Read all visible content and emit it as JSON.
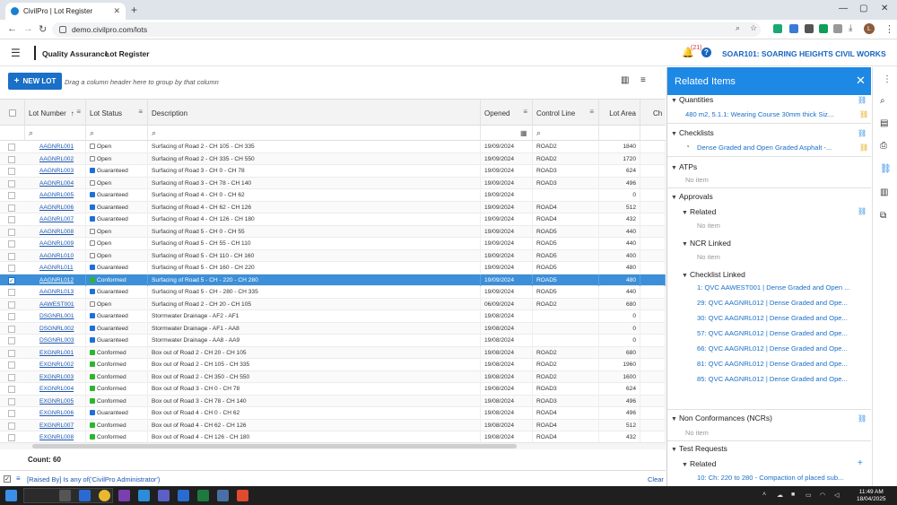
{
  "browser": {
    "tab_title": "CivilPro | Lot Register",
    "url": "demo.civilpro.com/lots",
    "profile_initial": "L"
  },
  "app": {
    "module": "Quality Assurance",
    "page": "Lot Register",
    "notification_count": "(21)",
    "org": "SOAR101: SOARING HEIGHTS CIVIL WORKS"
  },
  "toolbar": {
    "new_lot_label": "NEW LOT",
    "group_hint": "Drag a column header here to group by that column"
  },
  "grid": {
    "columns": [
      "Lot Number",
      "Lot Status",
      "Description",
      "Opened",
      "Control Line",
      "Lot Area",
      "Ch"
    ],
    "rows": [
      {
        "lot": "AAGNRL001",
        "status": "Open",
        "desc": "Surfacing of Road 2 - CH 105 - CH 335",
        "opened": "19/09/2024",
        "cl": "ROAD2",
        "area": "1840"
      },
      {
        "lot": "AAGNRL002",
        "status": "Open",
        "desc": "Surfacing of Road 2 - CH 335 - CH 550",
        "opened": "19/09/2024",
        "cl": "ROAD2",
        "area": "1720"
      },
      {
        "lot": "AAGNRL003",
        "status": "Guaranteed",
        "desc": "Surfacing of Road 3 - CH 0 - CH 78",
        "opened": "19/09/2024",
        "cl": "ROAD3",
        "area": "624"
      },
      {
        "lot": "AAGNRL004",
        "status": "Open",
        "desc": "Surfacing of Road 3 - CH 78 - CH 140",
        "opened": "19/09/2024",
        "cl": "ROAD3",
        "area": "496"
      },
      {
        "lot": "AAGNRL005",
        "status": "Guaranteed",
        "desc": "Surfacing of Road 4 - CH 0 - CH 62",
        "opened": "19/09/2024",
        "cl": "",
        "area": "0"
      },
      {
        "lot": "AAGNRL006",
        "status": "Guaranteed",
        "desc": "Surfacing of Road 4 - CH 62 - CH 126",
        "opened": "19/09/2024",
        "cl": "ROAD4",
        "area": "512"
      },
      {
        "lot": "AAGNRL007",
        "status": "Guaranteed",
        "desc": "Surfacing of Road 4 - CH 126 - CH 180",
        "opened": "19/09/2024",
        "cl": "ROAD4",
        "area": "432"
      },
      {
        "lot": "AAGNRL008",
        "status": "Open",
        "desc": "Surfacing of Road 5 - CH 0 - CH 55",
        "opened": "19/09/2024",
        "cl": "ROAD5",
        "area": "440"
      },
      {
        "lot": "AAGNRL009",
        "status": "Open",
        "desc": "Surfacing of Road 5 - CH 55 - CH 110",
        "opened": "19/09/2024",
        "cl": "ROAD5",
        "area": "440"
      },
      {
        "lot": "AAGNRL010",
        "status": "Open",
        "desc": "Surfacing of Road 5 - CH 110 - CH 160",
        "opened": "19/09/2024",
        "cl": "ROAD5",
        "area": "400"
      },
      {
        "lot": "AAGNRL011",
        "status": "Guaranteed",
        "desc": "Surfacing of Road 5 - CH 160 - CH 220",
        "opened": "19/09/2024",
        "cl": "ROAD5",
        "area": "480"
      },
      {
        "lot": "AAGNRL012",
        "status": "Conformed",
        "desc": "Surfacing of Road 5 - CH - 220 - CH 280",
        "opened": "19/09/2024",
        "cl": "ROAD5",
        "area": "480",
        "selected": true
      },
      {
        "lot": "AAGNRL013",
        "status": "Guaranteed",
        "desc": "Surfacing of Road 5 - CH - 280 - CH 335",
        "opened": "19/09/2024",
        "cl": "ROAD5",
        "area": "440"
      },
      {
        "lot": "AAWEST001",
        "status": "Open",
        "desc": "Surfacing of Road 2 - CH 20 - CH 105",
        "opened": "06/09/2024",
        "cl": "ROAD2",
        "area": "680"
      },
      {
        "lot": "DSGNRL001",
        "status": "Guaranteed",
        "desc": "Stormwater Drainage - AF2 - AF1",
        "opened": "19/08/2024",
        "cl": "",
        "area": "0"
      },
      {
        "lot": "DSGNRL002",
        "status": "Guaranteed",
        "desc": "Stormwater Drainage - AF1 - AA8",
        "opened": "19/08/2024",
        "cl": "",
        "area": "0"
      },
      {
        "lot": "DSGNRL003",
        "status": "Guaranteed",
        "desc": "Stormwater Drainage - AA8 - AA9",
        "opened": "19/08/2024",
        "cl": "",
        "area": "0"
      },
      {
        "lot": "EXGNRL001",
        "status": "Conformed",
        "desc": "Box out of Road 2 - CH 20 - CH 105",
        "opened": "19/08/2024",
        "cl": "ROAD2",
        "area": "680"
      },
      {
        "lot": "EXGNRL002",
        "status": "Conformed",
        "desc": "Box out of Road 2 - CH 105 - CH 335",
        "opened": "19/08/2024",
        "cl": "ROAD2",
        "area": "1960"
      },
      {
        "lot": "EXGNRL003",
        "status": "Conformed",
        "desc": "Box out of Road 2 - CH 350 - CH 550",
        "opened": "19/08/2024",
        "cl": "ROAD2",
        "area": "1600"
      },
      {
        "lot": "EXGNRL004",
        "status": "Conformed",
        "desc": "Box out of Road 3 - CH 0 - CH 78",
        "opened": "19/08/2024",
        "cl": "ROAD3",
        "area": "624"
      },
      {
        "lot": "EXGNRL005",
        "status": "Conformed",
        "desc": "Box out of Road 3 - CH 78 - CH 140",
        "opened": "19/08/2024",
        "cl": "ROAD3",
        "area": "496"
      },
      {
        "lot": "EXGNRL006",
        "status": "Guaranteed",
        "desc": "Box out of Road 4 - CH 0 - CH 62",
        "opened": "19/08/2024",
        "cl": "ROAD4",
        "area": "496"
      },
      {
        "lot": "EXGNRL007",
        "status": "Conformed",
        "desc": "Box out of Road 4 - CH 62 - CH 126",
        "opened": "19/08/2024",
        "cl": "ROAD4",
        "area": "512"
      },
      {
        "lot": "EXGNRL008",
        "status": "Conformed",
        "desc": "Box out of Road 4 - CH 126 - CH 180",
        "opened": "19/08/2024",
        "cl": "ROAD4",
        "area": "432"
      }
    ],
    "count_label": "Count: 60",
    "active_filter": "[Raised By] Is any of('CivilPro Administrator')",
    "clear_label": "Clear"
  },
  "status_colors": {
    "Open": "#ffffff",
    "Guaranteed": "#1e6fd9",
    "Conformed": "#2db52d"
  },
  "related": {
    "title": "Related Items",
    "quantities_label": "Quantities",
    "quantities_item": "480 m2, 5.1.1: Wearing Course 30mm thick Siz...",
    "checklists_label": "Checklists",
    "checklists_item": "Dense Graded and Open Graded Asphalt -...",
    "atps_label": "ATPs",
    "no_item": "No item",
    "approvals_label": "Approvals",
    "related_label": "Related",
    "ncr_linked_label": "NCR Linked",
    "checklist_linked_label": "Checklist Linked",
    "checklist_linked_items": [
      "1: QVC AAWEST001 | Dense Graded and Open ...",
      "29: QVC AAGNRL012 | Dense Graded and Ope...",
      "30: QVC AAGNRL012 | Dense Graded and Ope...",
      "57: QVC AAGNRL012 | Dense Graded and Ope...",
      "66: QVC AAGNRL012 | Dense Graded and Ope...",
      "81: QVC AAGNRL012 | Dense Graded and Ope...",
      "85: QVC AAGNRL012 | Dense Graded and Ope..."
    ],
    "ncr_label": "Non Conformances (NCRs)",
    "test_requests_label": "Test Requests",
    "test_related_label": "Related",
    "test_item": "10: Ch: 220 to 280 - Compaction of placed sub..."
  },
  "taskbar": {
    "time": "11:49 AM",
    "date": "18/04/2025"
  }
}
